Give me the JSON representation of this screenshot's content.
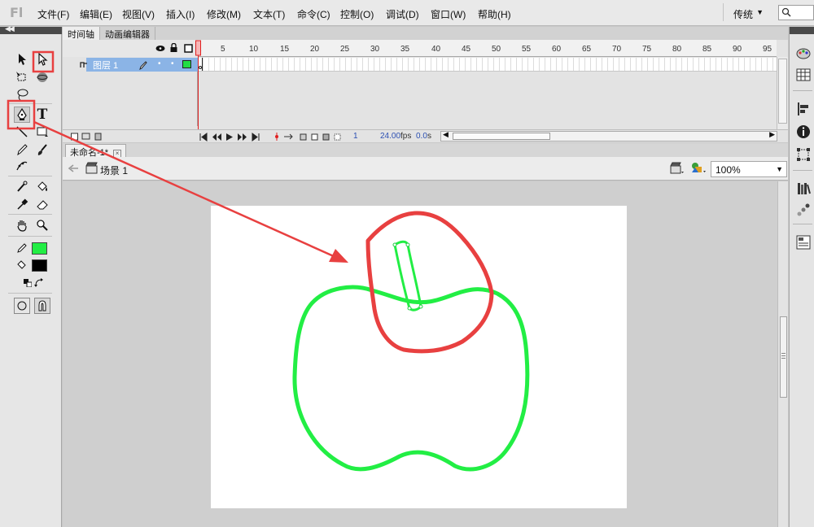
{
  "app": {
    "logo": "Fl"
  },
  "menu": [
    "文件(F)",
    "编辑(E)",
    "视图(V)",
    "插入(I)",
    "修改(M)",
    "文本(T)",
    "命令(C)",
    "控制(O)",
    "调试(D)",
    "窗口(W)",
    "帮助(H)"
  ],
  "workspace": {
    "label": "传统"
  },
  "panel_tabs": [
    "时间轴",
    "动画编辑器"
  ],
  "timeline": {
    "frame_ticks": [
      "1",
      "5",
      "10",
      "15",
      "20",
      "25",
      "30",
      "35",
      "40",
      "45",
      "50",
      "55",
      "60",
      "65",
      "70",
      "75",
      "80",
      "85",
      "90",
      "95"
    ],
    "layer_name": "图层 1",
    "current_frame": "1",
    "fps": "24.00",
    "fps_unit": "fps",
    "elapsed": "0.0",
    "elapsed_unit": "s"
  },
  "document": {
    "tab_title": "未命名-1*",
    "scene": "场景 1",
    "zoom": "100%"
  },
  "colors": {
    "stroke": "#22ee44",
    "fill": "#000000",
    "annotation": "#e84040",
    "apple": "#22ee44"
  },
  "icons": {
    "left_toolbox": [
      "selection-tool-icon",
      "subselection-tool-icon",
      "free-transform-icon",
      "3d-rotation-icon",
      "lasso-icon",
      "pen-tool-icon",
      "text-tool-icon",
      "line-tool-icon",
      "rectangle-tool-icon",
      "pencil-icon",
      "brush-icon",
      "deco-icon",
      "bone-icon",
      "paint-bucket-icon",
      "eyedropper-icon",
      "eraser-icon",
      "hand-icon",
      "zoom-icon",
      "stroke-color-icon",
      "fill-color-icon",
      "swap-colors-icon",
      "object-drawing-icon",
      "snap-icon"
    ],
    "right_panel": [
      "color-icon",
      "swatches-icon",
      "align-icon",
      "info-icon",
      "transform-icon",
      "library-icon",
      "motion-presets-icon",
      "components-icon"
    ]
  }
}
